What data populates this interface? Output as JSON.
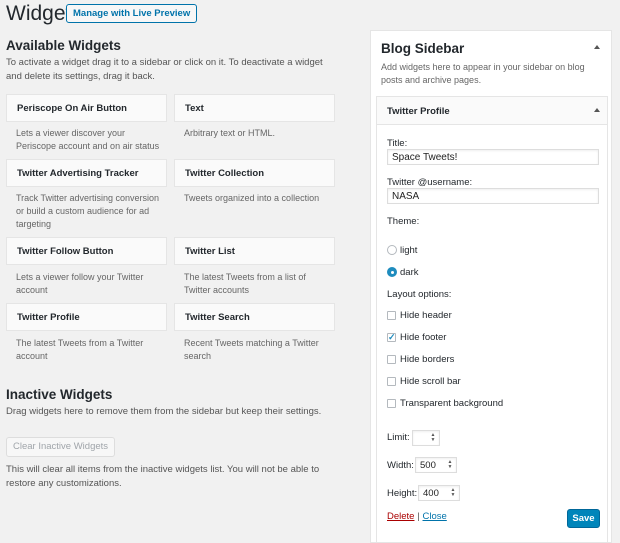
{
  "header": {
    "title": "Widgets",
    "preview_button": "Manage with Live Preview"
  },
  "available": {
    "title": "Available Widgets",
    "description": "To activate a widget drag it to a sidebar or click on it. To deactivate a widget and delete its settings, drag it back.",
    "widgets": [
      {
        "title": "Periscope On Air Button",
        "desc": "Lets a viewer discover your Periscope account and on air status"
      },
      {
        "title": "Text",
        "desc": "Arbitrary text or HTML."
      },
      {
        "title": "Twitter Advertising Tracker",
        "desc": "Track Twitter advertising conversion or build a custom audience for ad targeting"
      },
      {
        "title": "Twitter Collection",
        "desc": "Tweets organized into a collection"
      },
      {
        "title": "Twitter Follow Button",
        "desc": "Lets a viewer follow your Twitter account"
      },
      {
        "title": "Twitter List",
        "desc": "The latest Tweets from a list of Twitter accounts"
      },
      {
        "title": "Twitter Profile",
        "desc": "The latest Tweets from a Twitter account"
      },
      {
        "title": "Twitter Search",
        "desc": "Recent Tweets matching a Twitter search"
      }
    ]
  },
  "inactive": {
    "title": "Inactive Widgets",
    "description": "Drag widgets here to remove them from the sidebar but keep their settings.",
    "clear_button": "Clear Inactive Widgets",
    "note": "This will clear all items from the inactive widgets list. You will not be able to restore any customizations."
  },
  "sidebar": {
    "title": "Blog Sidebar",
    "description": "Add widgets here to appear in your sidebar on blog posts and archive pages.",
    "widget": {
      "title": "Twitter Profile",
      "title_label": "Title:",
      "title_value": "Space Tweets!",
      "username_label": "Twitter @username:",
      "username_value": "NASA",
      "theme_label": "Theme:",
      "theme_light": "light",
      "theme_dark": "dark",
      "layout_label": "Layout options:",
      "opt_hide_header": "Hide header",
      "opt_hide_footer": "Hide footer",
      "opt_hide_borders": "Hide borders",
      "opt_hide_scrollbar": "Hide scroll bar",
      "opt_transparent": "Transparent background",
      "limit_label": "Limit:",
      "limit_value": "",
      "width_label": "Width:",
      "width_value": "500",
      "height_label": "Height:",
      "height_value": "400",
      "delete_link": "Delete",
      "separator": "|",
      "close_link": "Close",
      "save_button": "Save"
    }
  },
  "colors": {
    "accent": "#0073aa",
    "primary_button": "#0085ba",
    "delete": "#a00000",
    "background": "#f1f1f1"
  }
}
